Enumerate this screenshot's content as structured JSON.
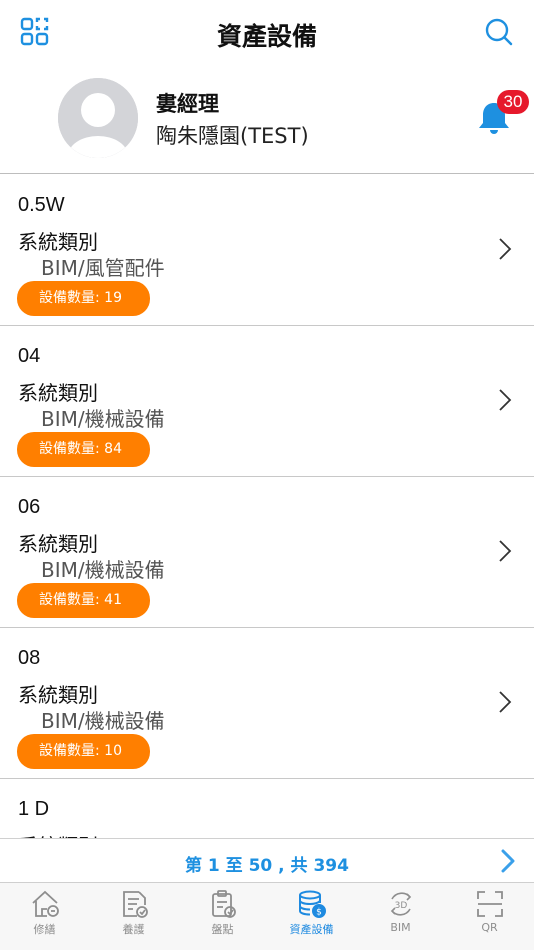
{
  "header": {
    "title": "資產設備",
    "left_icon": "grid-icon",
    "right_icon": "search-icon",
    "accent": "#1e90e0"
  },
  "profile": {
    "name": "婁經理",
    "site": "陶朱隱園(TEST)",
    "notification_count": "30",
    "bell_color": "#1e90e0",
    "badge_color": "#e6192c"
  },
  "items": [
    {
      "name": "0.5W",
      "category_label": "系統類別",
      "category_value": "BIM/風管配件",
      "count_text": "設備數量: 19"
    },
    {
      "name": "04",
      "category_label": "系統類別",
      "category_value": "BIM/機械設備",
      "count_text": "設備數量: 84"
    },
    {
      "name": "06",
      "category_label": "系統類別",
      "category_value": "BIM/機械設備",
      "count_text": "設備數量: 41"
    },
    {
      "name": "08",
      "category_label": "系統類別",
      "category_value": "BIM/機械設備",
      "count_text": "設備數量: 10"
    },
    {
      "name": "1 D",
      "category_label": "系統類別",
      "category_value": "",
      "count_text": ""
    }
  ],
  "pager": {
    "text": "第 1 至 50 , 共 394"
  },
  "tabs": [
    {
      "label": "修繕",
      "icon": "repair-house-icon",
      "active": false
    },
    {
      "label": "養護",
      "icon": "maintenance-doc-icon",
      "active": false
    },
    {
      "label": "盤點",
      "icon": "inventory-clipboard-icon",
      "active": false
    },
    {
      "label": "資產設備",
      "icon": "asset-database-icon",
      "active": true
    },
    {
      "label": "BIM",
      "icon": "bim-3d-icon",
      "active": false
    },
    {
      "label": "QR",
      "icon": "qr-scan-icon",
      "active": false
    }
  ],
  "colors": {
    "count_pill": "#ff7f00",
    "tab_active": "#1e8ae0",
    "tab_inactive": "#8e8e8e"
  }
}
